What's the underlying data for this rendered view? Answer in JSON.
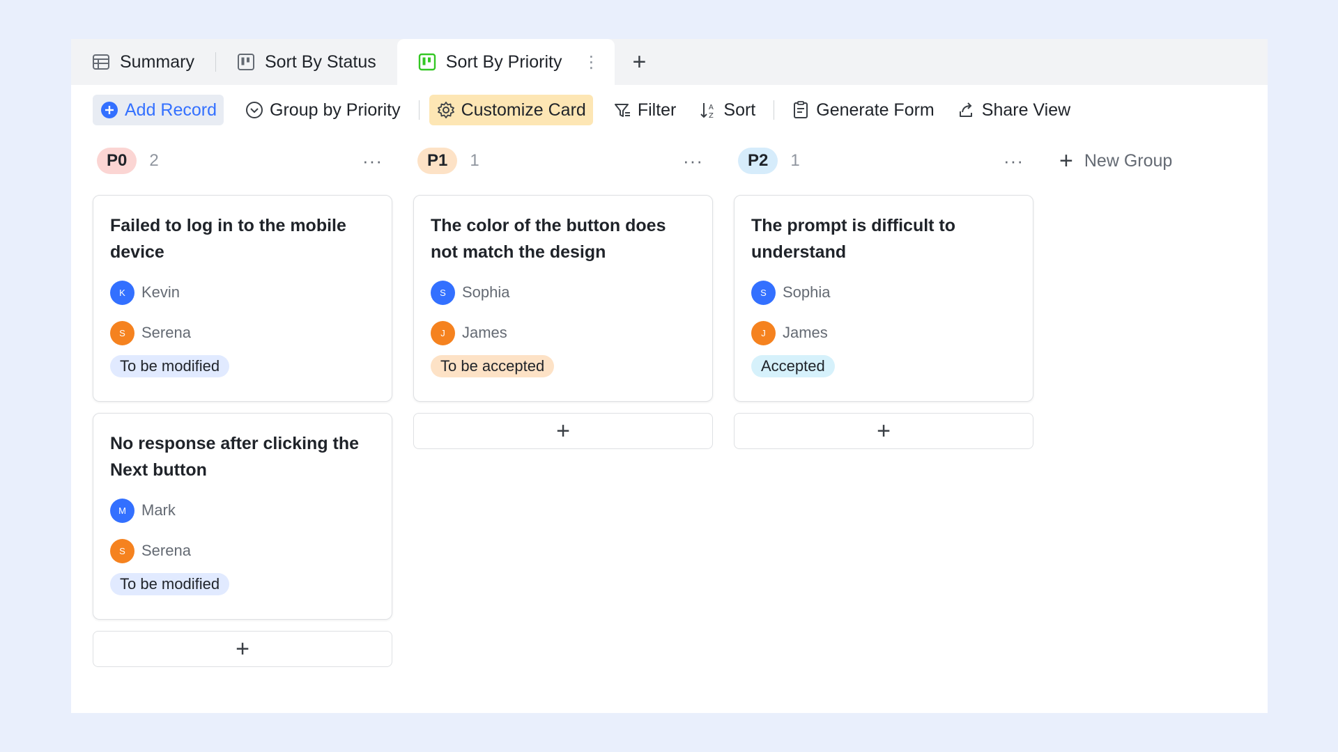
{
  "tabs": [
    {
      "label": "Summary",
      "icon": "table-icon"
    },
    {
      "label": "Sort By Status",
      "icon": "kanban-icon"
    },
    {
      "label": "Sort By Priority",
      "icon": "kanban-green-icon",
      "active": true
    }
  ],
  "tab_more": "⋮",
  "tab_add": "+",
  "toolbar": {
    "add_record": "Add Record",
    "group_by": "Group by Priority",
    "customize_card": "Customize Card",
    "filter": "Filter",
    "sort": "Sort",
    "generate_form": "Generate Form",
    "share_view": "Share View"
  },
  "colors": {
    "accent": "#3370ff",
    "p0": "#fbd5d3",
    "p1": "#fde2c6",
    "p2": "#d6ecfb",
    "tag_modified": "#e1eaff",
    "tag_to_accept": "#fde2c6",
    "tag_accepted": "#d6f1fb",
    "avatar_blue": "#3370ff",
    "avatar_orange": "#f5821f"
  },
  "groups": [
    {
      "label": "P0",
      "count": "2",
      "more": "···",
      "cards": [
        {
          "title": "Failed to log in to the mobile device",
          "people": [
            {
              "initial": "K",
              "name": "Kevin"
            },
            {
              "initial": "S",
              "name": "Serena"
            }
          ],
          "status": "To be modified"
        },
        {
          "title": "No response after clicking the Next button",
          "people": [
            {
              "initial": "M",
              "name": "Mark"
            },
            {
              "initial": "S",
              "name": "Serena"
            }
          ],
          "status": "To be modified"
        }
      ],
      "add": "+"
    },
    {
      "label": "P1",
      "count": "1",
      "more": "···",
      "cards": [
        {
          "title": "The color of the button does not match the design",
          "people": [
            {
              "initial": "S",
              "name": "Sophia"
            },
            {
              "initial": "J",
              "name": "James"
            }
          ],
          "status": "To be accepted"
        }
      ],
      "add": "+"
    },
    {
      "label": "P2",
      "count": "1",
      "more": "···",
      "cards": [
        {
          "title": "The prompt is difficult to understand",
          "people": [
            {
              "initial": "S",
              "name": "Sophia"
            },
            {
              "initial": "J",
              "name": "James"
            }
          ],
          "status": "Accepted"
        }
      ],
      "add": "+"
    }
  ],
  "new_group": {
    "plus": "+",
    "label": "New Group"
  }
}
